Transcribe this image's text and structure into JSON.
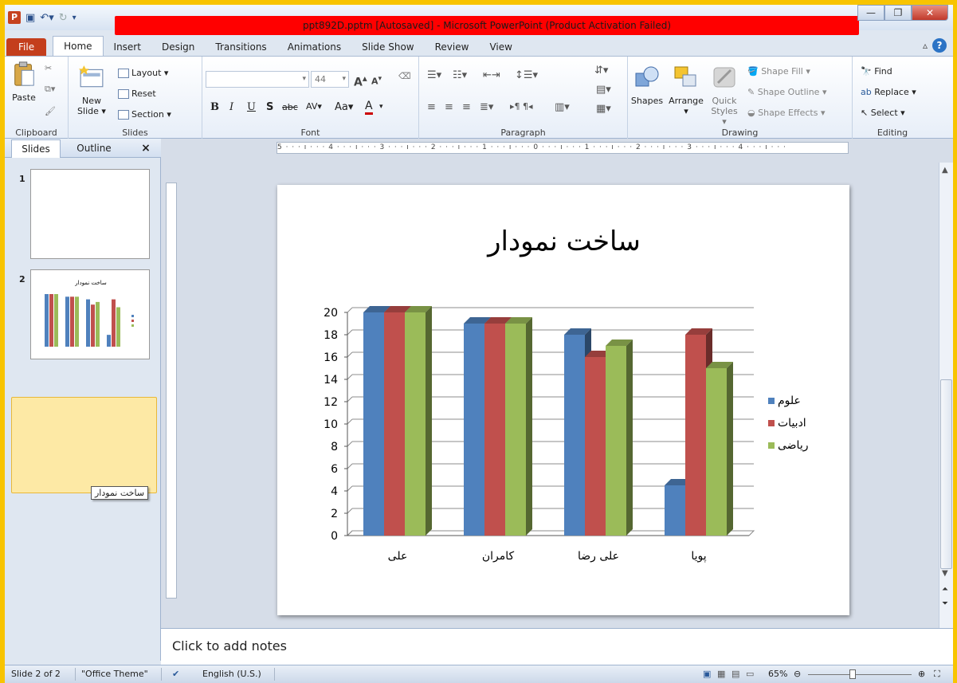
{
  "window": {
    "title": "ppt892D.pptm [Autosaved]  -  Microsoft PowerPoint (Product Activation Failed)"
  },
  "tabs": [
    "File",
    "Home",
    "Insert",
    "Design",
    "Transitions",
    "Animations",
    "Slide Show",
    "Review",
    "View"
  ],
  "ribbon": {
    "clipboard": {
      "paste": "Paste",
      "label": "Clipboard"
    },
    "slides": {
      "new_slide_1": "New",
      "new_slide_2": "Slide",
      "layout": "Layout",
      "reset": "Reset",
      "section": "Section",
      "label": "Slides"
    },
    "font": {
      "size": "44",
      "grow": "A",
      "shrink": "A",
      "bold": "B",
      "italic": "I",
      "underline": "U",
      "shadow": "S",
      "strike": "abc",
      "spacing": "AV",
      "case": "Aa",
      "color": "A",
      "label": "Font"
    },
    "paragraph": {
      "label": "Paragraph"
    },
    "drawing": {
      "shapes": "Shapes",
      "arrange": "Arrange",
      "quick_1": "Quick",
      "quick_2": "Styles",
      "fill": "Shape Fill",
      "outline": "Shape Outline",
      "effects": "Shape Effects",
      "label": "Drawing"
    },
    "editing": {
      "find": "Find",
      "replace": "Replace",
      "select": "Select",
      "label": "Editing"
    }
  },
  "left_pane": {
    "tab_slides": "Slides",
    "tab_outline": "Outline",
    "close": "×",
    "slide1_num": "1",
    "slide2_num": "2",
    "tooltip": "ساخت نمودار"
  },
  "ruler": {
    "text": "5 · · · ı · · · 4 · · · ı · · · 3 · · · ı · · · 2 · · · ı · · · 1 · · · ı · · · 0 · · · ı · · · 1 · · · ı · · · 2 · · · ı · · · 3 · · · ı · · · 4 · · · ı · · ·"
  },
  "slide": {
    "title": "ساخت نمودار"
  },
  "chart_data": {
    "type": "bar",
    "title": "ساخت نمودار",
    "xlabel": "",
    "ylabel": "",
    "categories": [
      "علی",
      "کامران",
      "علی رضا",
      "پویا"
    ],
    "series": [
      {
        "name": "علوم",
        "values": [
          20,
          19,
          18,
          4.5
        ],
        "color": "#4f81bd"
      },
      {
        "name": "ادبیات",
        "values": [
          20,
          19,
          16,
          18
        ],
        "color": "#c0504d"
      },
      {
        "name": "ریاضی",
        "values": [
          20,
          19,
          17,
          15
        ],
        "color": "#9bbb59"
      }
    ],
    "ylim": [
      0,
      20
    ],
    "yticks": [
      "0",
      "2",
      "4",
      "6",
      "8",
      "10",
      "12",
      "14",
      "16",
      "18",
      "20"
    ],
    "grid": true,
    "legend": "right",
    "style": "3d clustered column"
  },
  "notes": {
    "placeholder": "Click to add notes"
  },
  "status": {
    "slide": "Slide 2 of 2",
    "theme": "\"Office Theme\"",
    "language": "English (U.S.)",
    "zoom": "65%"
  }
}
